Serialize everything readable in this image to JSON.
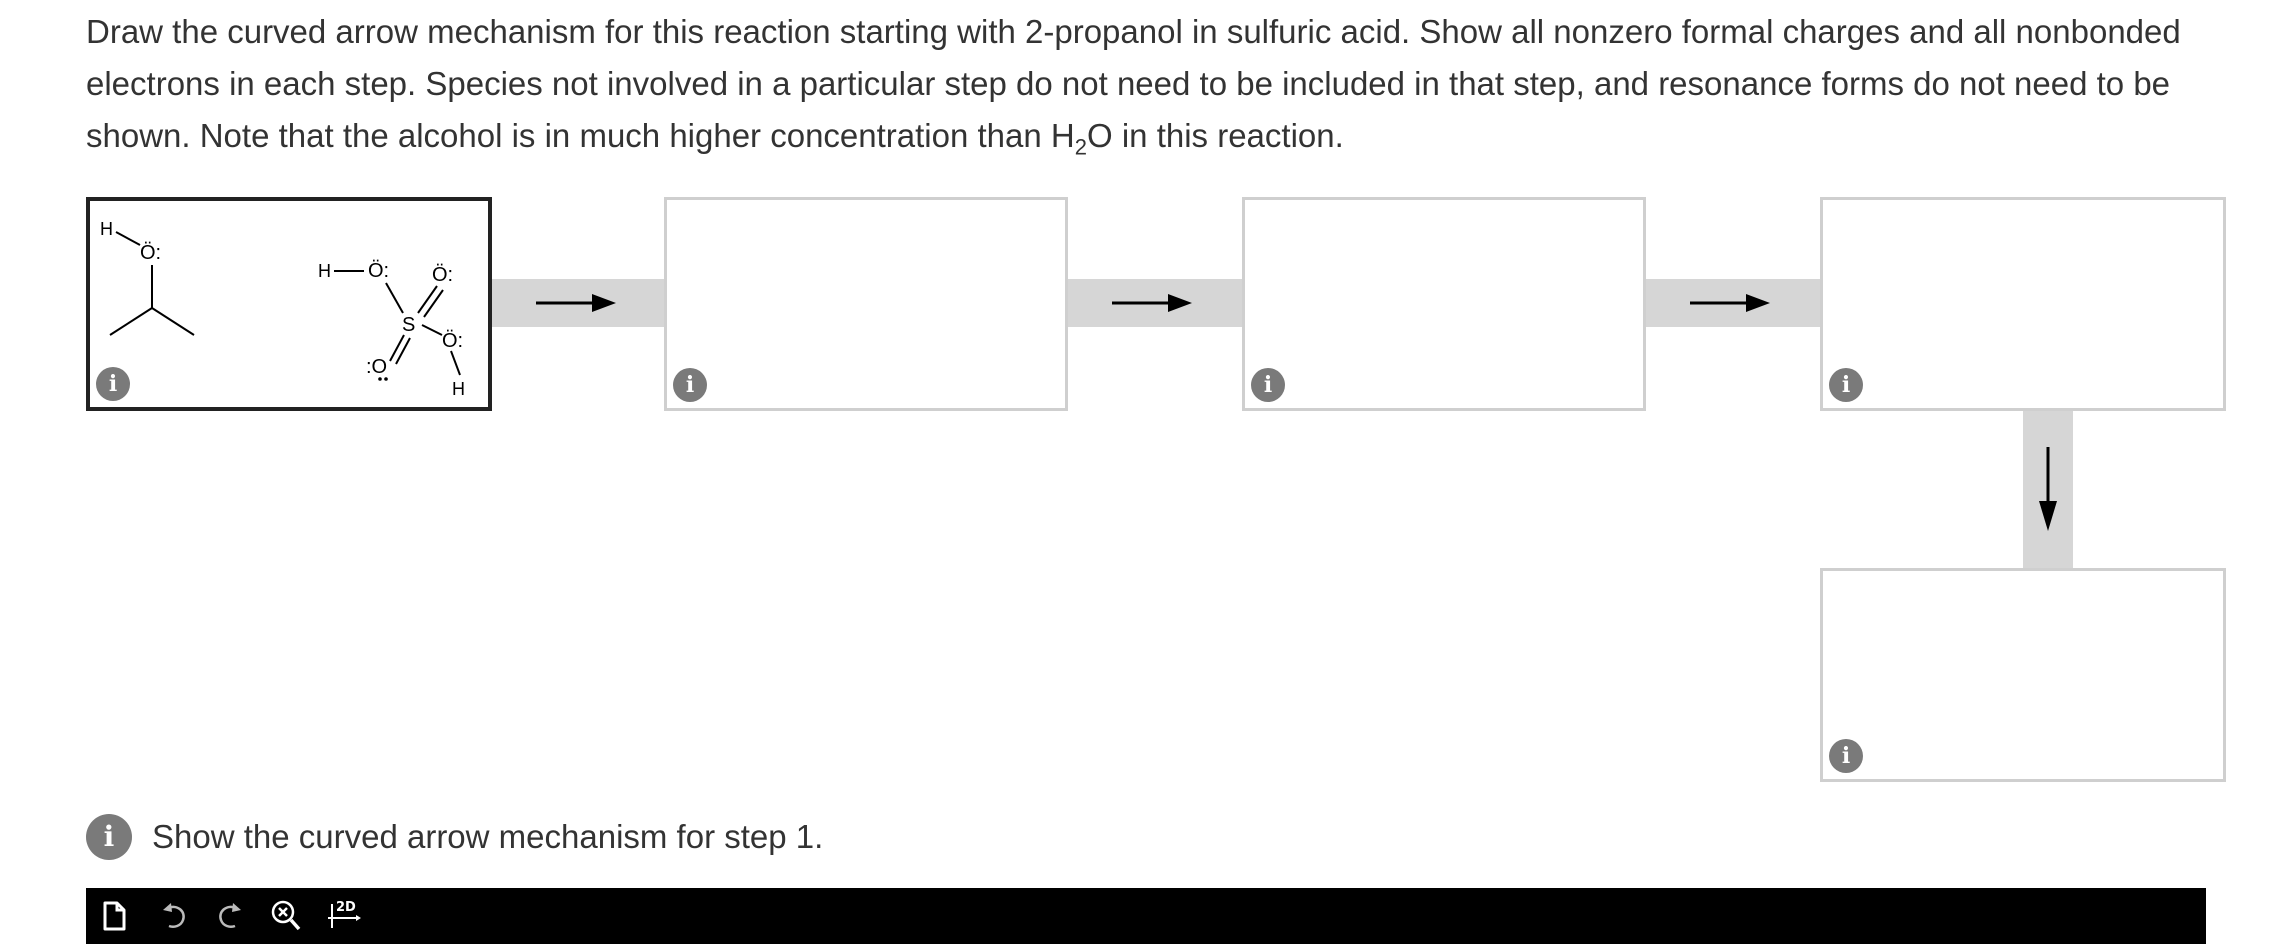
{
  "question": {
    "part1": "Draw the curved arrow mechanism for this reaction starting with 2-propanol in sulfuric acid. Show all nonzero formal charges and all nonbonded electrons in each step. Species not involved in a particular step do not need to be included in that step, and resonance forms do not need to be shown. Note that the alcohol is in much higher concentration than H",
    "subscript": "2",
    "part2": "O in this reaction."
  },
  "info_glyph": "i",
  "molecule_labels": {
    "h": "H",
    "o_lone": "Ö:",
    "o_colon": ":O",
    "s": "S"
  },
  "steps": [
    {
      "label": "step-1",
      "active": true
    },
    {
      "label": "step-2",
      "active": false
    },
    {
      "label": "step-3",
      "active": false
    },
    {
      "label": "step-4",
      "active": false
    },
    {
      "label": "step-5",
      "active": false
    }
  ],
  "hint": {
    "text": "Show the curved arrow mechanism for step 1."
  },
  "toolbar": {
    "items": [
      "new-document-icon",
      "undo-icon",
      "redo-icon",
      "zoom-reset-icon",
      "clean-2d-icon"
    ],
    "clean_label": "2D"
  },
  "colors": {
    "text": "#333333",
    "connector": "#d6d6d6",
    "box_border": "#cfcfcf",
    "active_border": "#222222",
    "toolbar_bg": "#000000",
    "info_icon": "#7a7a7a"
  }
}
